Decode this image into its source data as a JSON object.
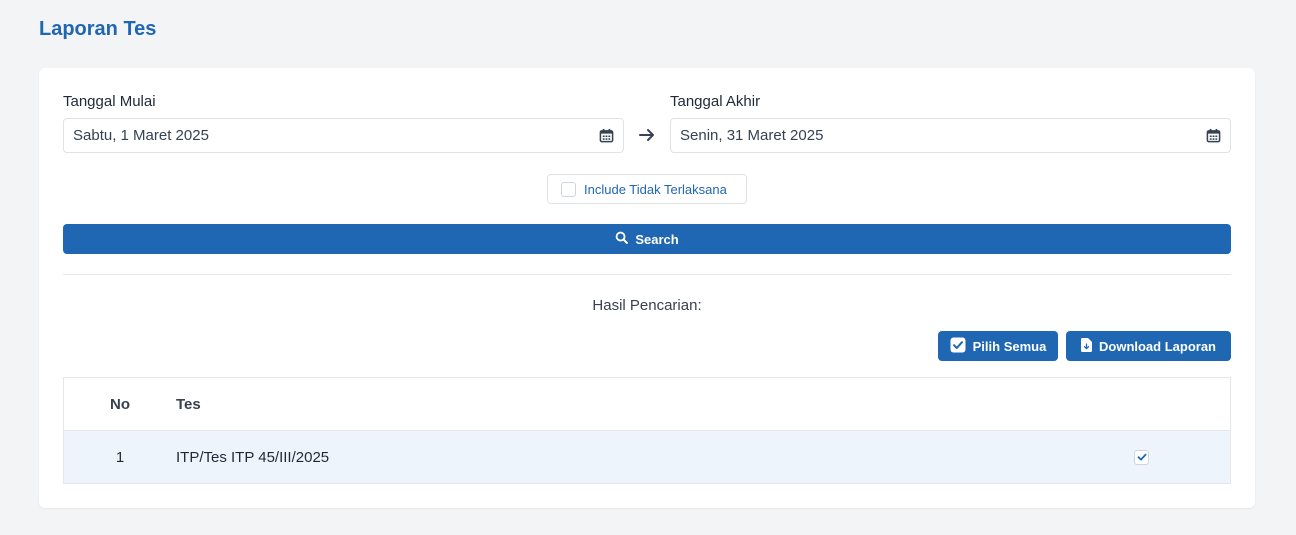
{
  "page": {
    "title": "Laporan Tes"
  },
  "filters": {
    "start_label": "Tanggal Mulai",
    "start_value": "Sabtu, 1 Maret 2025",
    "end_label": "Tanggal Akhir",
    "end_value": "Senin, 31 Maret 2025",
    "include_label": "Include Tidak Terlaksana",
    "include_checked": false
  },
  "search": {
    "label": "Search"
  },
  "results": {
    "heading": "Hasil Pencarian:",
    "select_all_label": "Pilih Semua",
    "download_label": "Download Laporan",
    "columns": {
      "no": "No",
      "tes": "Tes"
    },
    "rows": [
      {
        "no": "1",
        "tes": "ITP/Tes ITP 45/III/2025",
        "checked": true
      }
    ]
  },
  "colors": {
    "primary": "#1f66b3",
    "row_highlight": "#eef4fc",
    "background": "#f3f4f6"
  },
  "icons": [
    "calendar-icon",
    "arrow-right-icon",
    "search-icon",
    "check-square-icon",
    "file-download-icon",
    "check-icon"
  ]
}
